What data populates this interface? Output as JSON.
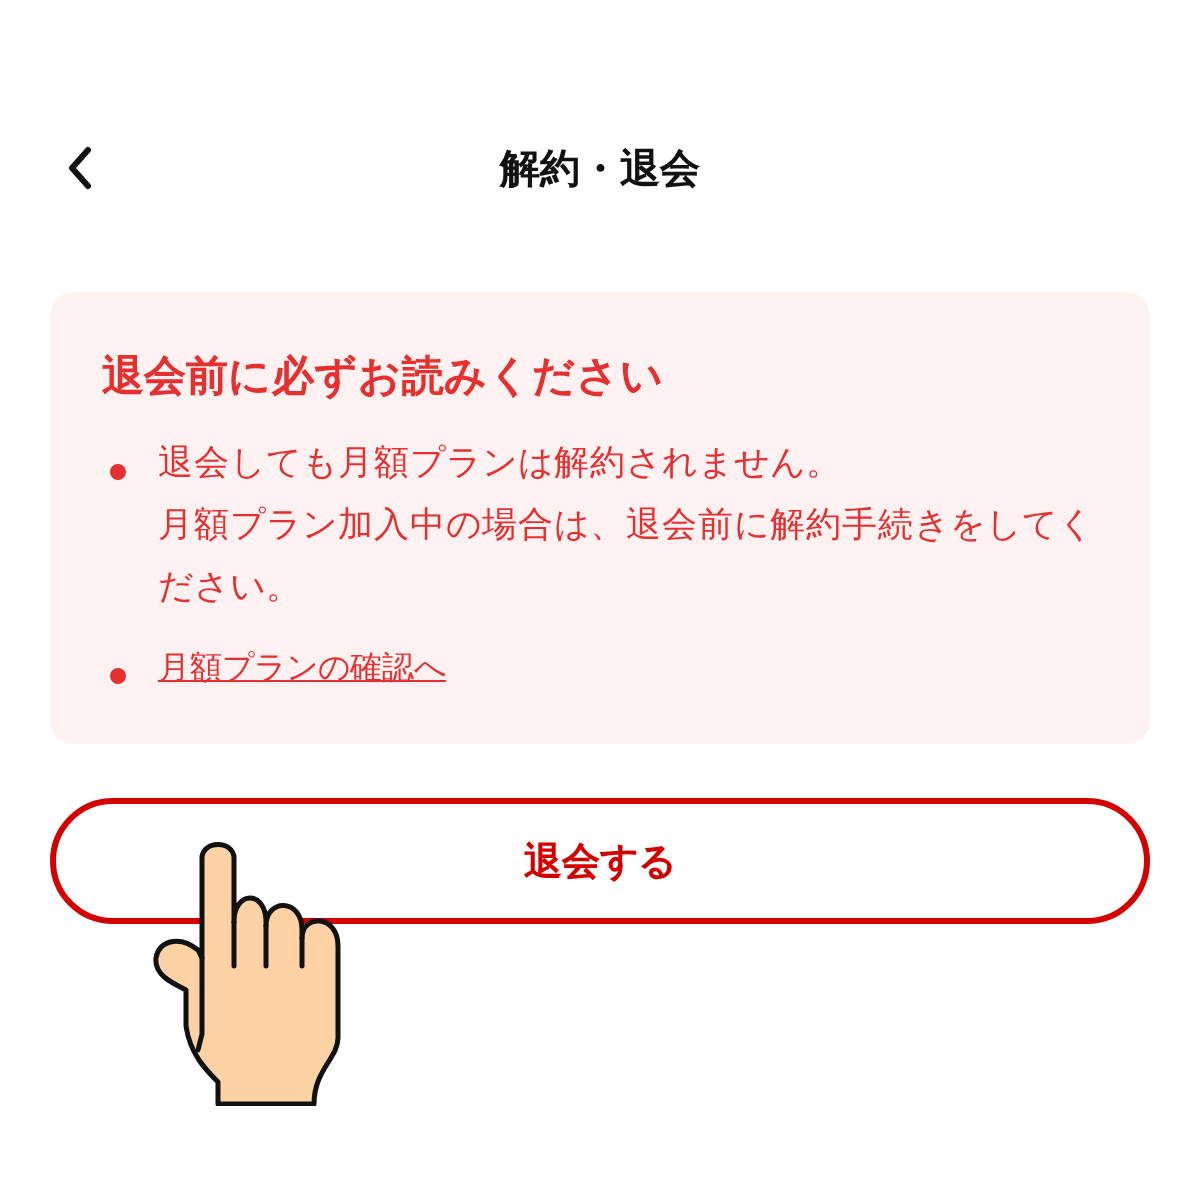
{
  "header": {
    "title": "解約・退会"
  },
  "notice": {
    "title": "退会前に必ずお読みください",
    "items": [
      {
        "kind": "text",
        "lines": [
          "退会しても月額プランは解約されません。",
          "月額プラン加入中の場合は、退会前に解約手続きをしてください。"
        ]
      },
      {
        "kind": "link",
        "text": "月額プランの確認へ"
      }
    ]
  },
  "button": {
    "label": "退会する"
  }
}
